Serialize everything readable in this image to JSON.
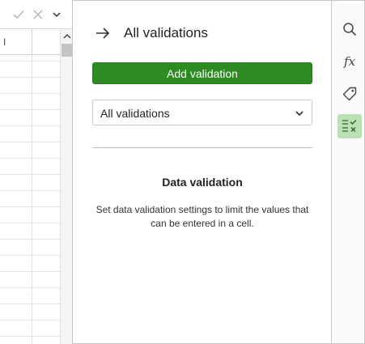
{
  "sheet": {
    "columns": [
      "I",
      ""
    ],
    "formula_bar": {
      "confirm_icon": "check-icon",
      "cancel_icon": "x-icon",
      "expand_icon": "chevron-down-icon"
    }
  },
  "panel": {
    "back_icon": "arrow-right-icon",
    "title": "All validations",
    "add_button_label": "Add validation",
    "filter_select": {
      "selected": "All validations"
    },
    "empty_state": {
      "title": "Data validation",
      "description": "Set data validation settings to limit the values that can be entered in a cell."
    }
  },
  "sidebar": {
    "items": [
      {
        "icon": "search-icon",
        "active": false
      },
      {
        "icon": "function-icon",
        "label": "fx",
        "active": false
      },
      {
        "icon": "tag-icon",
        "active": false
      },
      {
        "icon": "data-validation-icon",
        "active": true
      }
    ]
  },
  "colors": {
    "accent_green": "#2e8b24",
    "active_tab_bg": "#b9e2b3"
  }
}
